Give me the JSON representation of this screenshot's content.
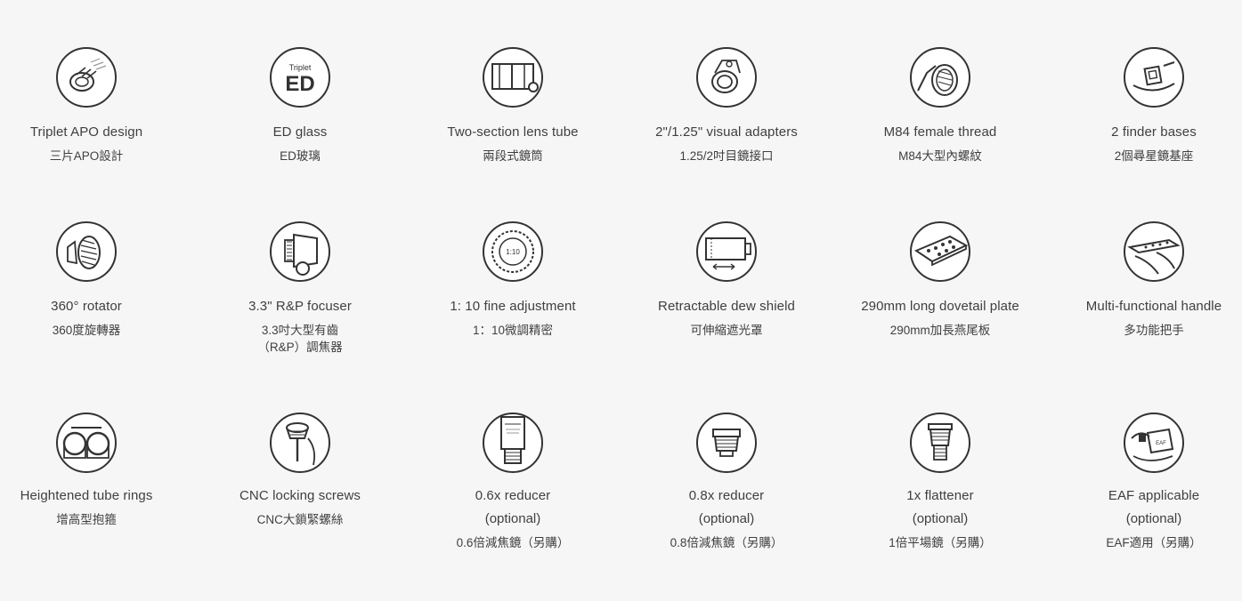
{
  "features": [
    {
      "en": "Triplet APO design",
      "zh": "三片APO設計",
      "icon": "triplet-lens-icon"
    },
    {
      "en": "ED glass",
      "zh": "ED玻璃",
      "icon": "ed-glass-icon",
      "icon_text_top": "Triplet",
      "icon_text_main": "ED"
    },
    {
      "en": "Two-section lens tube",
      "zh": "兩段式鏡筒",
      "icon": "lens-tube-icon"
    },
    {
      "en": "2\"/1.25\" visual adapters",
      "zh": "1.25/2吋目鏡接口",
      "icon": "visual-adapter-icon"
    },
    {
      "en": "M84 female thread",
      "zh": "M84大型內螺紋",
      "icon": "female-thread-icon"
    },
    {
      "en": "2 finder bases",
      "zh": "2個尋星鏡基座",
      "icon": "finder-base-icon"
    },
    {
      "en": "360° rotator",
      "zh": "360度旋轉器",
      "icon": "rotator-icon"
    },
    {
      "en": "3.3\" R&P focuser",
      "zh": "3.3吋大型有齒",
      "zh2": "（R&P）調焦器",
      "icon": "focuser-icon"
    },
    {
      "en": "1: 10 fine adjustment",
      "zh": "1：10微調精密",
      "icon": "fine-adjustment-icon",
      "icon_text_main": "1:10"
    },
    {
      "en": "Retractable dew shield",
      "zh": "可伸縮遮光罩",
      "icon": "dew-shield-icon"
    },
    {
      "en": "290mm long dovetail plate",
      "zh": "290mm加長燕尾板",
      "icon": "dovetail-plate-icon"
    },
    {
      "en": "Multi-functional handle",
      "zh": "多功能把手",
      "icon": "handle-icon"
    },
    {
      "en": "Heightened tube rings",
      "zh": "增高型抱箍",
      "icon": "tube-rings-icon"
    },
    {
      "en": "CNC locking screws",
      "zh": "CNC大鎖緊螺絲",
      "icon": "locking-screw-icon"
    },
    {
      "en": "0.6x reducer",
      "opt": "(optional)",
      "zh": "0.6倍減焦鏡（另購）",
      "icon": "reducer-06-icon"
    },
    {
      "en": "0.8x reducer",
      "opt": "(optional)",
      "zh": "0.8倍減焦鏡（另購）",
      "icon": "reducer-08-icon"
    },
    {
      "en": "1x flattener",
      "opt": "(optional)",
      "zh": "1倍平場鏡（另購）",
      "icon": "flattener-icon"
    },
    {
      "en": "EAF applicable",
      "opt": "(optional)",
      "zh": "EAF適用（另購）",
      "icon": "eaf-icon",
      "icon_text_main": "EAF"
    }
  ]
}
